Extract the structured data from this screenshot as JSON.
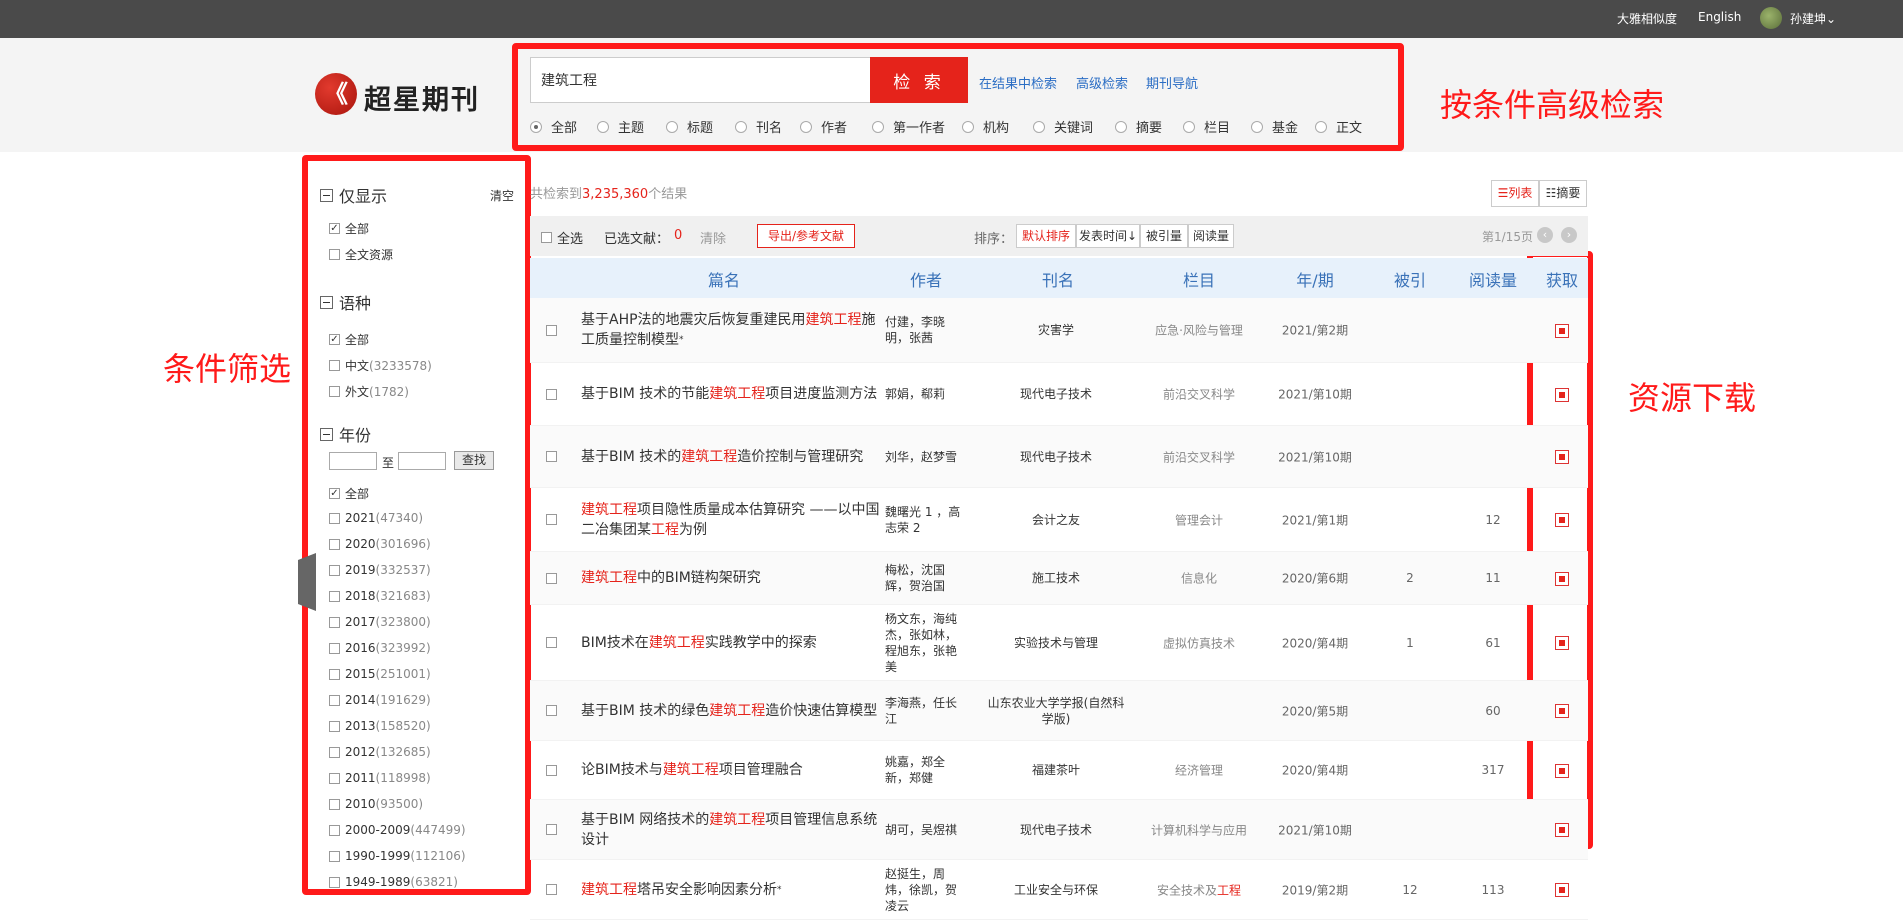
{
  "topbar": {
    "similarity": "大雅相似度",
    "english": "English",
    "user": "孙建坤"
  },
  "brand": {
    "logo_text": "超星期刊"
  },
  "search": {
    "value": "建筑工程",
    "button": "检 索",
    "links": [
      "在结果中检索",
      "高级检索",
      "期刊导航"
    ],
    "scopes": [
      "全部",
      "主题",
      "标题",
      "刊名",
      "作者",
      "第一作者",
      "机构",
      "关键词",
      "摘要",
      "栏目",
      "基金",
      "正文"
    ],
    "selected_scope": "全部"
  },
  "annotations": {
    "advanced": "按条件高级检索",
    "filter": "条件筛选",
    "download": "资源下载"
  },
  "sidebar": {
    "show_only": {
      "title": "仅显示",
      "clear": "清空",
      "options": [
        {
          "label": "全部",
          "checked": true
        },
        {
          "label": "全文资源",
          "checked": false
        }
      ]
    },
    "language": {
      "title": "语种",
      "options": [
        {
          "label": "全部",
          "count": "",
          "checked": true
        },
        {
          "label": "中文",
          "count": "(3233578)",
          "checked": false
        },
        {
          "label": "外文",
          "count": "(1782)",
          "checked": false
        }
      ]
    },
    "year": {
      "title": "年份",
      "to": "至",
      "find": "查找",
      "options": [
        {
          "label": "全部",
          "count": "",
          "checked": true
        },
        {
          "label": "2021",
          "count": "(47340)"
        },
        {
          "label": "2020",
          "count": "(301696)"
        },
        {
          "label": "2019",
          "count": "(332537)"
        },
        {
          "label": "2018",
          "count": "(321683)"
        },
        {
          "label": "2017",
          "count": "(323800)"
        },
        {
          "label": "2016",
          "count": "(323992)"
        },
        {
          "label": "2015",
          "count": "(251001)"
        },
        {
          "label": "2014",
          "count": "(191629)"
        },
        {
          "label": "2013",
          "count": "(158520)"
        },
        {
          "label": "2012",
          "count": "(132685)"
        },
        {
          "label": "2011",
          "count": "(118998)"
        },
        {
          "label": "2010",
          "count": "(93500)"
        },
        {
          "label": "2000-2009",
          "count": "(447499)"
        },
        {
          "label": "1990-1999",
          "count": "(112106)"
        },
        {
          "label": "1949-1989",
          "count": "(63821)"
        }
      ]
    }
  },
  "results": {
    "prefix": "共检索到",
    "total": "3,235,360",
    "suffix": "个结果",
    "view_list": "列表",
    "view_abstract": "摘要",
    "select_all": "全选",
    "selected_label": "已选文献：",
    "selected_count": "0",
    "clear": "清除",
    "export": "导出/参考文献",
    "sort_label": "排序：",
    "sort_options": [
      "默认排序",
      "发表时间↓",
      "被引量",
      "阅读量"
    ],
    "page": "第1/15页",
    "columns": [
      "篇名",
      "作者",
      "刊名",
      "栏目",
      "年/期",
      "被引",
      "阅读量",
      "获取"
    ],
    "rows": [
      {
        "title": [
          [
            "基于AHP法的地震灾后恢复重建民用",
            0
          ],
          [
            "建筑工程",
            1
          ],
          [
            "施工质量控制模型",
            0
          ]
        ],
        "star": true,
        "authors": "付建，李晓明，张茜",
        "journal": "灾害学",
        "column": [
          [
            "应急·风险与管理",
            0
          ]
        ],
        "issue": "2021/第2期",
        "cited": "",
        "reads": ""
      },
      {
        "title": [
          [
            "基于BIM 技术的节能",
            0
          ],
          [
            "建筑工程",
            1
          ],
          [
            "项目进度监测方法",
            0
          ]
        ],
        "star": false,
        "authors": "郭娟，郗莉",
        "journal": "现代电子技术",
        "column": [
          [
            "前沿交叉科学",
            0
          ]
        ],
        "issue": "2021/第10期",
        "cited": "",
        "reads": ""
      },
      {
        "title": [
          [
            "基于BIM 技术的",
            0
          ],
          [
            "建筑工程",
            1
          ],
          [
            "造价控制与管理研究",
            0
          ]
        ],
        "star": false,
        "authors": "刘华，赵梦雪",
        "journal": "现代电子技术",
        "column": [
          [
            "前沿交叉科学",
            0
          ]
        ],
        "issue": "2021/第10期",
        "cited": "",
        "reads": ""
      },
      {
        "title": [
          [
            "建筑工程",
            1
          ],
          [
            "项目隐性质量成本估算研究 ——以中国二冶集团某",
            0
          ],
          [
            "工程",
            1
          ],
          [
            "为例",
            0
          ]
        ],
        "star": false,
        "authors": "魏曙光 1 ，高志荣 2",
        "journal": "会计之友",
        "column": [
          [
            "管理会计",
            0
          ]
        ],
        "issue": "2021/第1期",
        "cited": "",
        "reads": "12"
      },
      {
        "title": [
          [
            "建筑工程",
            1
          ],
          [
            "中的BIM链构架研究",
            0
          ]
        ],
        "star": false,
        "authors": "梅松，沈国辉，贺治国",
        "journal": "施工技术",
        "column": [
          [
            "信息化",
            0
          ]
        ],
        "issue": "2020/第6期",
        "cited": "2",
        "reads": "11"
      },
      {
        "title": [
          [
            "BIM技术在",
            0
          ],
          [
            "建筑工程",
            1
          ],
          [
            "实践教学中的探索",
            0
          ]
        ],
        "star": false,
        "authors": "杨文东，海纯杰，张如林，程旭东，张艳美",
        "journal": "实验技术与管理",
        "column": [
          [
            "虚拟仿真技术",
            0
          ]
        ],
        "issue": "2020/第4期",
        "cited": "1",
        "reads": "61"
      },
      {
        "title": [
          [
            "基于BIM 技术的绿色",
            0
          ],
          [
            "建筑工程",
            1
          ],
          [
            "造价快速估算模型",
            0
          ]
        ],
        "star": false,
        "authors": "李海燕，任长江",
        "journal": "山东农业大学学报(自然科学版)",
        "column": [
          [
            "",
            0
          ]
        ],
        "issue": "2020/第5期",
        "cited": "",
        "reads": "60"
      },
      {
        "title": [
          [
            "论BIM技术与",
            0
          ],
          [
            "建筑工程",
            1
          ],
          [
            "项目管理融合",
            0
          ]
        ],
        "star": false,
        "authors": "姚嘉，郑全新，郑健",
        "journal": "福建茶叶",
        "column": [
          [
            "经济管理",
            0
          ]
        ],
        "issue": "2020/第4期",
        "cited": "",
        "reads": "317"
      },
      {
        "title": [
          [
            "基于BIM 网络技术的",
            0
          ],
          [
            "建筑工程",
            1
          ],
          [
            "项目管理信息系统设计",
            0
          ]
        ],
        "star": false,
        "authors": "胡可，吴煜祺",
        "journal": "现代电子技术",
        "column": [
          [
            "计算机科学与应用",
            0
          ]
        ],
        "issue": "2021/第10期",
        "cited": "",
        "reads": ""
      },
      {
        "title": [
          [
            "建筑工程",
            1
          ],
          [
            "塔吊安全影响因素分析",
            0
          ]
        ],
        "star": true,
        "authors": "赵挺生，周炜，徐凯，贺凌云",
        "journal": "工业安全与环保",
        "column": [
          [
            "安全技术及",
            0
          ],
          [
            "工程",
            1
          ]
        ],
        "issue": "2019/第2期",
        "cited": "12",
        "reads": "113"
      }
    ]
  }
}
